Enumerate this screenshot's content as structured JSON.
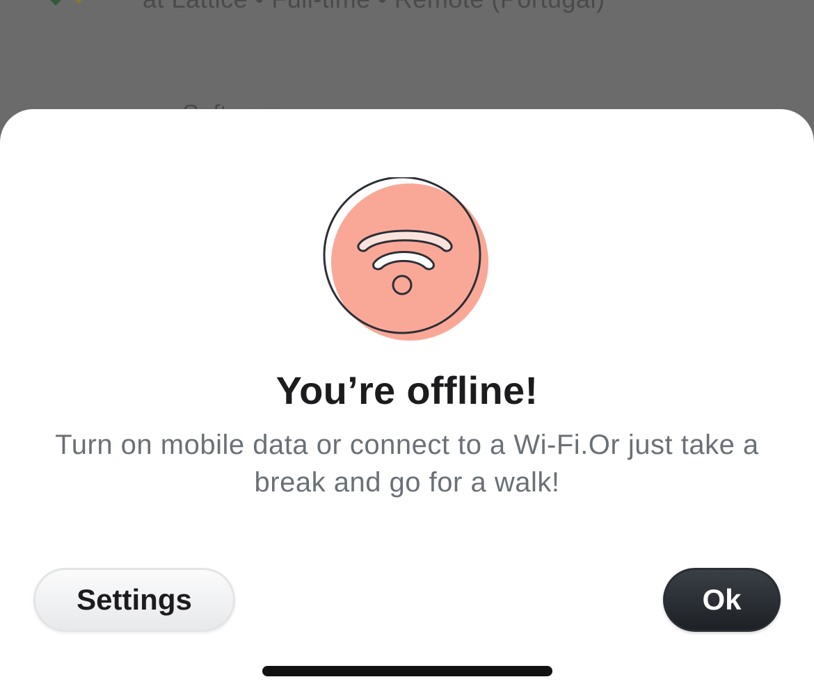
{
  "background": {
    "job_subtitle": "at Lattice • Full-time • Remote (Portugal)",
    "fragment_text": "Software"
  },
  "dialog": {
    "icon": "wifi-offline-icon",
    "title": "You’re offline!",
    "message": "Turn on mobile data or connect to a Wi-Fi.Or just take a break and go for a walk!",
    "settings_label": "Settings",
    "ok_label": "Ok"
  },
  "colors": {
    "icon_blob": "#F9A898",
    "ok_button": "#22262b",
    "overlay": "#6b6b6b"
  }
}
